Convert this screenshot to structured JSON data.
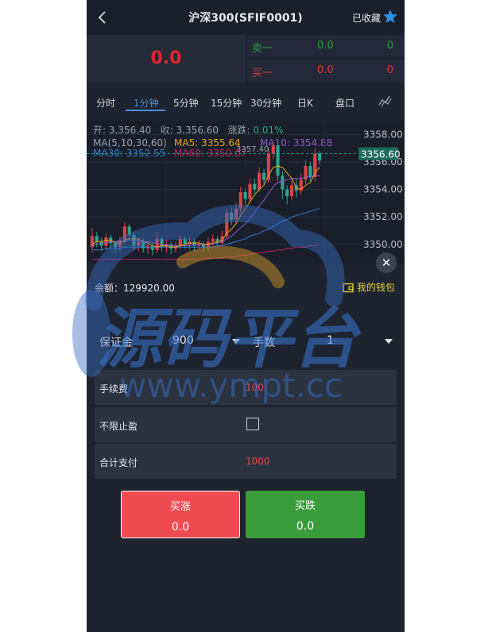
{
  "header": {
    "title": "沪深300(SFIF0001)",
    "favorite_label": "已收藏"
  },
  "quote": {
    "price": "0.0",
    "ask": {
      "label": "卖一",
      "price": "0.0",
      "volume": "0"
    },
    "bid": {
      "label": "买一",
      "price": "0.0",
      "volume": "0"
    }
  },
  "tabs": [
    "分时",
    "1分钟",
    "5分钟",
    "15分钟",
    "30分钟",
    "日K",
    "盘口"
  ],
  "active_tab": "1分钟",
  "chart_info": {
    "open_label": "开: 3,356.40",
    "close_label": "收: 3,356.60",
    "change_label": "涨跌:",
    "change_value": "0.01%",
    "ma_params": "MA(5,10,30,60)",
    "ma5": "MA5: 3355.64",
    "ma10": "MA10: 3354.88",
    "ma30": "MA30: 3352.55",
    "ma60": "MA60: 3350.07",
    "high_marker": "3357.40"
  },
  "chart_data": {
    "type": "candlestick",
    "y_ticks": [
      "3358.00",
      "3356.00",
      "3354.00",
      "3352.00",
      "3350.00"
    ],
    "ylim": [
      3348.6,
      3359.0
    ],
    "current_price_label": "3356.60",
    "current_price": 3356.6,
    "candles": [
      {
        "o": 3349.8,
        "c": 3350.6,
        "h": 3351.2,
        "l": 3349.4
      },
      {
        "o": 3350.6,
        "c": 3350.2,
        "h": 3350.9,
        "l": 3349.8
      },
      {
        "o": 3350.2,
        "c": 3349.9,
        "h": 3350.5,
        "l": 3349.5
      },
      {
        "o": 3349.9,
        "c": 3350.5,
        "h": 3350.8,
        "l": 3349.6
      },
      {
        "o": 3350.5,
        "c": 3350.1,
        "h": 3350.7,
        "l": 3349.7
      },
      {
        "o": 3350.1,
        "c": 3349.8,
        "h": 3350.3,
        "l": 3349.4
      },
      {
        "o": 3349.8,
        "c": 3350.3,
        "h": 3350.6,
        "l": 3349.5
      },
      {
        "o": 3350.3,
        "c": 3351.3,
        "h": 3351.6,
        "l": 3350.0
      },
      {
        "o": 3351.3,
        "c": 3350.7,
        "h": 3351.5,
        "l": 3350.3
      },
      {
        "o": 3350.7,
        "c": 3349.9,
        "h": 3350.9,
        "l": 3349.6
      },
      {
        "o": 3349.9,
        "c": 3350.2,
        "h": 3350.5,
        "l": 3349.5
      },
      {
        "o": 3350.2,
        "c": 3349.7,
        "h": 3350.4,
        "l": 3349.4
      },
      {
        "o": 3349.7,
        "c": 3349.9,
        "h": 3350.2,
        "l": 3349.3
      },
      {
        "o": 3349.9,
        "c": 3349.6,
        "h": 3350.1,
        "l": 3349.2
      },
      {
        "o": 3349.6,
        "c": 3350.4,
        "h": 3350.9,
        "l": 3349.4
      },
      {
        "o": 3350.4,
        "c": 3349.8,
        "h": 3350.6,
        "l": 3349.5
      },
      {
        "o": 3349.8,
        "c": 3350.0,
        "h": 3350.3,
        "l": 3349.4
      },
      {
        "o": 3350.0,
        "c": 3349.7,
        "h": 3350.2,
        "l": 3349.3
      },
      {
        "o": 3349.7,
        "c": 3349.9,
        "h": 3350.2,
        "l": 3349.4
      },
      {
        "o": 3349.9,
        "c": 3350.4,
        "h": 3350.7,
        "l": 3349.6
      },
      {
        "o": 3350.4,
        "c": 3350.0,
        "h": 3350.6,
        "l": 3349.7
      },
      {
        "o": 3350.0,
        "c": 3350.2,
        "h": 3350.5,
        "l": 3349.6
      },
      {
        "o": 3350.2,
        "c": 3349.9,
        "h": 3350.4,
        "l": 3349.5
      },
      {
        "o": 3349.9,
        "c": 3350.0,
        "h": 3350.3,
        "l": 3349.6
      },
      {
        "o": 3350.0,
        "c": 3349.8,
        "h": 3350.2,
        "l": 3349.4
      },
      {
        "o": 3349.8,
        "c": 3350.2,
        "h": 3350.5,
        "l": 3349.5
      },
      {
        "o": 3350.2,
        "c": 3350.4,
        "h": 3350.7,
        "l": 3349.9
      },
      {
        "o": 3350.4,
        "c": 3350.1,
        "h": 3350.6,
        "l": 3349.8
      },
      {
        "o": 3350.1,
        "c": 3350.6,
        "h": 3351.0,
        "l": 3349.9
      },
      {
        "o": 3350.6,
        "c": 3352.3,
        "h": 3352.6,
        "l": 3350.4
      },
      {
        "o": 3352.3,
        "c": 3351.8,
        "h": 3352.7,
        "l": 3351.4
      },
      {
        "o": 3351.8,
        "c": 3352.6,
        "h": 3353.0,
        "l": 3351.5
      },
      {
        "o": 3352.6,
        "c": 3353.8,
        "h": 3354.2,
        "l": 3352.3
      },
      {
        "o": 3353.8,
        "c": 3353.3,
        "h": 3354.0,
        "l": 3352.9
      },
      {
        "o": 3353.3,
        "c": 3354.4,
        "h": 3354.8,
        "l": 3353.0
      },
      {
        "o": 3354.4,
        "c": 3354.0,
        "h": 3354.8,
        "l": 3353.7
      },
      {
        "o": 3354.0,
        "c": 3355.2,
        "h": 3355.6,
        "l": 3353.8
      },
      {
        "o": 3355.2,
        "c": 3354.7,
        "h": 3355.5,
        "l": 3354.3
      },
      {
        "o": 3354.7,
        "c": 3356.6,
        "h": 3357.0,
        "l": 3354.5
      },
      {
        "o": 3356.6,
        "c": 3357.2,
        "h": 3357.4,
        "l": 3356.2
      },
      {
        "o": 3357.2,
        "c": 3355.0,
        "h": 3357.4,
        "l": 3354.6
      },
      {
        "o": 3355.0,
        "c": 3354.0,
        "h": 3355.3,
        "l": 3353.3
      },
      {
        "o": 3354.0,
        "c": 3353.5,
        "h": 3354.3,
        "l": 3352.9
      },
      {
        "o": 3353.5,
        "c": 3354.3,
        "h": 3354.7,
        "l": 3353.2
      },
      {
        "o": 3354.3,
        "c": 3353.9,
        "h": 3354.8,
        "l": 3353.4
      },
      {
        "o": 3353.9,
        "c": 3354.7,
        "h": 3355.2,
        "l": 3353.6
      },
      {
        "o": 3354.7,
        "c": 3355.7,
        "h": 3356.1,
        "l": 3354.4
      },
      {
        "o": 3355.7,
        "c": 3354.9,
        "h": 3356.0,
        "l": 3354.5
      },
      {
        "o": 3354.9,
        "c": 3356.6,
        "h": 3357.0,
        "l": 3354.6
      },
      {
        "o": 3356.6,
        "c": 3356.1,
        "h": 3356.8,
        "l": 3355.8
      }
    ],
    "ma5": [
      3350.0,
      3350.2,
      3350.2,
      3350.3,
      3350.3,
      3350.1,
      3350.1,
      3350.3,
      3350.4,
      3350.4,
      3350.4,
      3350.2,
      3350.1,
      3349.9,
      3349.8,
      3349.9,
      3349.9,
      3349.8,
      3349.8,
      3349.9,
      3350.0,
      3350.1,
      3350.1,
      3350.1,
      3350.0,
      3350.0,
      3350.1,
      3350.2,
      3350.3,
      3350.8,
      3351.1,
      3351.5,
      3352.1,
      3352.6,
      3353.1,
      3353.6,
      3354.0,
      3354.3,
      3355.0,
      3355.6,
      3355.7,
      3355.6,
      3355.2,
      3354.8,
      3354.1,
      3354.0,
      3354.3,
      3354.5,
      3355.2,
      3355.6
    ],
    "ma10": [
      3349.9,
      3350.0,
      3350.1,
      3350.1,
      3350.2,
      3350.2,
      3350.2,
      3350.2,
      3350.3,
      3350.3,
      3350.3,
      3350.2,
      3350.2,
      3350.1,
      3350.1,
      3350.0,
      3350.0,
      3349.9,
      3349.9,
      3349.9,
      3349.9,
      3349.9,
      3350.0,
      3350.0,
      3350.0,
      3350.0,
      3350.0,
      3350.1,
      3350.2,
      3350.4,
      3350.6,
      3350.9,
      3351.2,
      3351.5,
      3351.9,
      3352.3,
      3352.8,
      3353.2,
      3353.7,
      3354.2,
      3354.5,
      3354.6,
      3354.7,
      3354.8,
      3354.8,
      3354.8,
      3354.9,
      3354.9,
      3355.0,
      3355.0
    ],
    "ma30": [
      3349.6,
      3349.6,
      3349.6,
      3349.7,
      3349.7,
      3349.7,
      3349.7,
      3349.8,
      3349.8,
      3349.8,
      3349.8,
      3349.8,
      3349.8,
      3349.8,
      3349.8,
      3349.8,
      3349.8,
      3349.8,
      3349.8,
      3349.8,
      3349.8,
      3349.8,
      3349.8,
      3349.8,
      3349.8,
      3349.8,
      3349.8,
      3349.9,
      3349.9,
      3350.0,
      3350.1,
      3350.2,
      3350.3,
      3350.4,
      3350.6,
      3350.7,
      3350.8,
      3351.0,
      3351.1,
      3351.3,
      3351.5,
      3351.7,
      3351.8,
      3352.0,
      3352.1,
      3352.2,
      3352.3,
      3352.4,
      3352.5,
      3352.6
    ],
    "ma60": [
      3348.9,
      3348.9,
      3348.9,
      3348.9,
      3348.9,
      3348.9,
      3348.9,
      3348.9,
      3348.9,
      3348.9,
      3348.9,
      3348.9,
      3348.9,
      3348.9,
      3348.9,
      3348.9,
      3348.9,
      3348.9,
      3348.9,
      3348.9,
      3348.9,
      3348.9,
      3348.9,
      3348.9,
      3349.0,
      3349.0,
      3349.0,
      3349.0,
      3349.0,
      3349.1,
      3349.1,
      3349.1,
      3349.2,
      3349.2,
      3349.3,
      3349.3,
      3349.4,
      3349.4,
      3349.5,
      3349.5,
      3349.6,
      3349.6,
      3349.7,
      3349.7,
      3349.8,
      3349.8,
      3349.8,
      3349.9,
      3349.9,
      3350.0
    ]
  },
  "balance": {
    "label": "余额：129920.00",
    "wallet_label": "我的钱包"
  },
  "order": {
    "margin_label": "保证金",
    "margin_value": "900",
    "lots_label": "手数",
    "lots_value": "1",
    "fee_label": "手续费",
    "fee_value": "100",
    "nolimit_label": "不限止盈",
    "total_label": "合计支付",
    "total_value": "1000"
  },
  "buttons": {
    "buy_up_label": "买涨",
    "buy_up_value": "0.0",
    "buy_down_label": "买跌",
    "buy_down_value": "0.0"
  },
  "watermark": {
    "brand": "源码平台",
    "url": "www.ympt.cc"
  },
  "colors": {
    "up": "#e0424a",
    "down": "#2ea68f",
    "ma5": "#e8a21a",
    "ma10": "#8e5cc9",
    "ma30": "#2f7fd0",
    "ma60": "#c0245e",
    "price_line": "#2a9d8f",
    "accent": "#4a90d9"
  }
}
